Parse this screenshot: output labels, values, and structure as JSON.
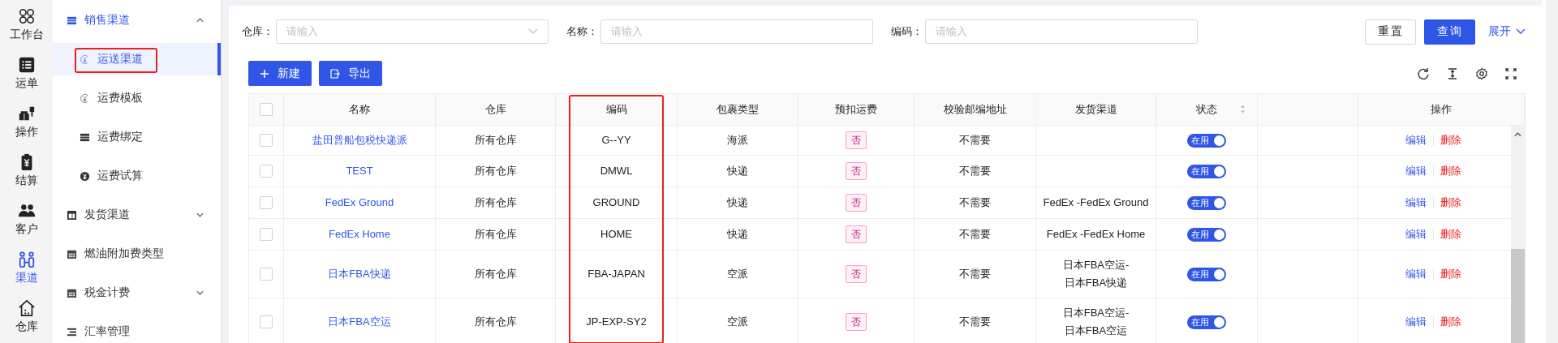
{
  "rail": [
    {
      "label": "工作台",
      "selected": false
    },
    {
      "label": "运单",
      "selected": false
    },
    {
      "label": "操作",
      "selected": false
    },
    {
      "label": "结算",
      "selected": false
    },
    {
      "label": "客户",
      "selected": false
    },
    {
      "label": "渠道",
      "selected": true
    },
    {
      "label": "仓库",
      "selected": false
    }
  ],
  "nav": [
    {
      "label": "销售渠道",
      "kind": "group",
      "expanded": true,
      "children": [
        {
          "label": "运送渠道",
          "selected": true,
          "highlighted": true
        },
        {
          "label": "运费模板",
          "selected": false,
          "highlighted": false
        },
        {
          "label": "运费绑定",
          "selected": false,
          "highlighted": false
        },
        {
          "label": "运费试算",
          "selected": false,
          "highlighted": false
        }
      ]
    },
    {
      "label": "发货渠道",
      "kind": "group",
      "expanded": false
    },
    {
      "label": "燃油附加费类型",
      "kind": "item"
    },
    {
      "label": "税金计费",
      "kind": "group",
      "expanded": false
    },
    {
      "label": "汇率管理",
      "kind": "item"
    }
  ],
  "filters": [
    {
      "label": "仓库：",
      "kind": "select",
      "placeholder": "请输入"
    },
    {
      "label": "名称：",
      "kind": "text",
      "placeholder": "请输入"
    },
    {
      "label": "编码：",
      "kind": "text",
      "placeholder": "请输入"
    }
  ],
  "filter_actions": {
    "reset": "重置",
    "query": "查询",
    "expand": "展开"
  },
  "toolbar": {
    "new": "新建",
    "export": "导出"
  },
  "table": {
    "columns": [
      {
        "kind": "check",
        "checked": false
      },
      {
        "kind": "text",
        "label": "名称"
      },
      {
        "kind": "text",
        "label": "仓库"
      },
      {
        "kind": "text",
        "label": "编码",
        "highlighted": true
      },
      {
        "kind": "text",
        "label": "包裹类型"
      },
      {
        "kind": "text",
        "label": "预扣运费"
      },
      {
        "kind": "text",
        "label": "校验邮编地址"
      },
      {
        "kind": "text",
        "label": "发货渠道"
      },
      {
        "kind": "sort",
        "label": "状态"
      },
      {
        "kind": "blank"
      },
      {
        "kind": "text",
        "label": "操作"
      }
    ],
    "rows": [
      {
        "name": "盐田普船包税快递派",
        "warehouse": "所有仓库",
        "code": "G--YY",
        "parcel_type": "海派",
        "prepaid": "否",
        "postcode_check": "不需要",
        "status": {
          "label": "在用",
          "on": true
        },
        "actions": [
          "编辑",
          "删除"
        ],
        "checked": false
      },
      {
        "name": "TEST",
        "warehouse": "所有仓库",
        "code": "DMWL",
        "parcel_type": "快递",
        "prepaid": "否",
        "postcode_check": "不需要",
        "status": {
          "label": "在用",
          "on": true
        },
        "actions": [
          "编辑",
          "删除"
        ],
        "checked": false
      },
      {
        "name": "FedEx Ground",
        "warehouse": "所有仓库",
        "code": "GROUND",
        "parcel_type": "快递",
        "prepaid": "否",
        "postcode_check": "不需要",
        "shipping_channel": "FedEx -FedEx Ground",
        "status": {
          "label": "在用",
          "on": true
        },
        "actions": [
          "编辑",
          "删除"
        ],
        "checked": false
      },
      {
        "name": "FedEx Home",
        "warehouse": "所有仓库",
        "code": "HOME",
        "parcel_type": "快递",
        "prepaid": "否",
        "postcode_check": "不需要",
        "shipping_channel": "FedEx -FedEx Home",
        "status": {
          "label": "在用",
          "on": true
        },
        "actions": [
          "编辑",
          "删除"
        ],
        "checked": false
      },
      {
        "name": "日本FBA快递",
        "warehouse": "所有仓库",
        "code": "FBA-JAPAN",
        "parcel_type": "空派",
        "prepaid": "否",
        "postcode_check": "不需要",
        "shipping_channel": "日本FBA空运-日本FBA快递",
        "status": {
          "label": "在用",
          "on": true
        },
        "actions": [
          "编辑",
          "删除"
        ],
        "checked": false
      },
      {
        "name": "日本FBA空运",
        "warehouse": "所有仓库",
        "code": "JP-EXP-SY2",
        "parcel_type": "空派",
        "prepaid": "否",
        "postcode_check": "不需要",
        "shipping_channel": "日本FBA空运-日本FBA空运",
        "status": {
          "label": "在用",
          "on": true
        },
        "actions": [
          "编辑",
          "删除"
        ],
        "checked": false
      }
    ]
  }
}
